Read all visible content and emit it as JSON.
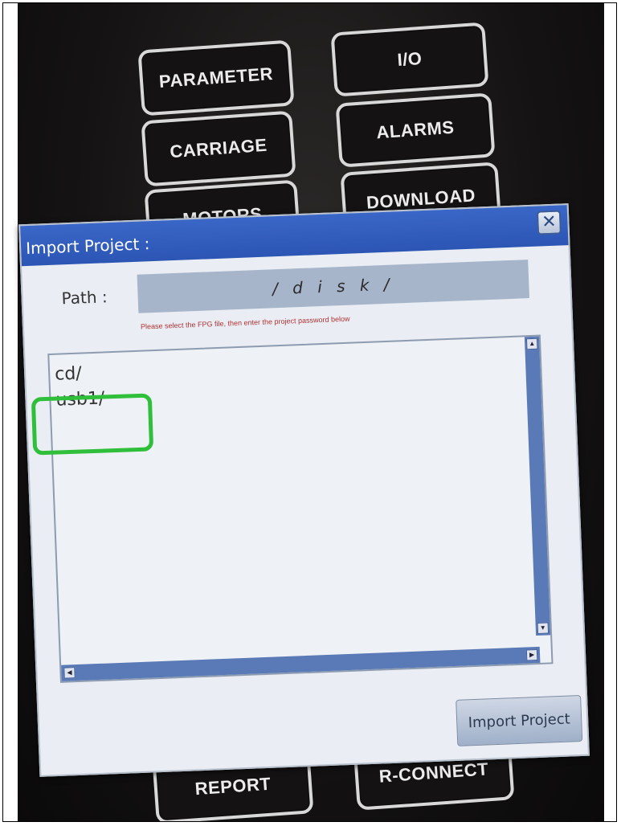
{
  "menu": {
    "parameter": "PARAMETER",
    "io": "I/O",
    "carriage": "CARRIAGE",
    "alarms": "ALARMS",
    "motors": "MOTORS",
    "download": "DOWNLOAD",
    "report": "REPORT",
    "rconnect": "R-CONNECT"
  },
  "dialog": {
    "title": "Import Project :",
    "close_symbol": "✕",
    "path_label": "Path :",
    "path_value": "/ d i s k /",
    "hint": "Please select the FPG file, then enter the project password below",
    "files": [
      "cd/",
      "usb1/"
    ],
    "import_button": "Import Project"
  },
  "colors": {
    "titlebar": "#2c55b4",
    "highlight": "#2fbf3a",
    "hint_text": "#b03232"
  }
}
